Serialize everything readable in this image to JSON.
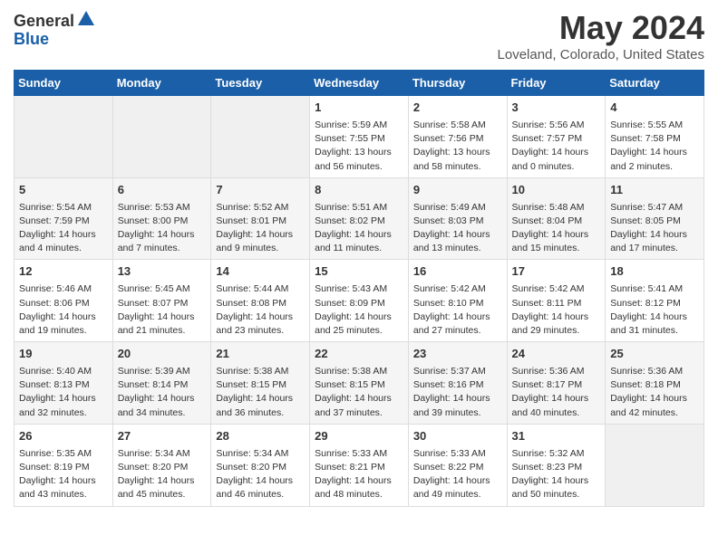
{
  "logo": {
    "general": "General",
    "blue": "Blue"
  },
  "title": "May 2024",
  "subtitle": "Loveland, Colorado, United States",
  "days": [
    "Sunday",
    "Monday",
    "Tuesday",
    "Wednesday",
    "Thursday",
    "Friday",
    "Saturday"
  ],
  "weeks": [
    [
      {
        "day": "",
        "sunrise": "",
        "sunset": "",
        "daylight": "",
        "empty": true
      },
      {
        "day": "",
        "sunrise": "",
        "sunset": "",
        "daylight": "",
        "empty": true
      },
      {
        "day": "",
        "sunrise": "",
        "sunset": "",
        "daylight": "",
        "empty": true
      },
      {
        "day": "1",
        "sunrise": "Sunrise: 5:59 AM",
        "sunset": "Sunset: 7:55 PM",
        "daylight": "Daylight: 13 hours and 56 minutes."
      },
      {
        "day": "2",
        "sunrise": "Sunrise: 5:58 AM",
        "sunset": "Sunset: 7:56 PM",
        "daylight": "Daylight: 13 hours and 58 minutes."
      },
      {
        "day": "3",
        "sunrise": "Sunrise: 5:56 AM",
        "sunset": "Sunset: 7:57 PM",
        "daylight": "Daylight: 14 hours and 0 minutes."
      },
      {
        "day": "4",
        "sunrise": "Sunrise: 5:55 AM",
        "sunset": "Sunset: 7:58 PM",
        "daylight": "Daylight: 14 hours and 2 minutes."
      }
    ],
    [
      {
        "day": "5",
        "sunrise": "Sunrise: 5:54 AM",
        "sunset": "Sunset: 7:59 PM",
        "daylight": "Daylight: 14 hours and 4 minutes."
      },
      {
        "day": "6",
        "sunrise": "Sunrise: 5:53 AM",
        "sunset": "Sunset: 8:00 PM",
        "daylight": "Daylight: 14 hours and 7 minutes."
      },
      {
        "day": "7",
        "sunrise": "Sunrise: 5:52 AM",
        "sunset": "Sunset: 8:01 PM",
        "daylight": "Daylight: 14 hours and 9 minutes."
      },
      {
        "day": "8",
        "sunrise": "Sunrise: 5:51 AM",
        "sunset": "Sunset: 8:02 PM",
        "daylight": "Daylight: 14 hours and 11 minutes."
      },
      {
        "day": "9",
        "sunrise": "Sunrise: 5:49 AM",
        "sunset": "Sunset: 8:03 PM",
        "daylight": "Daylight: 14 hours and 13 minutes."
      },
      {
        "day": "10",
        "sunrise": "Sunrise: 5:48 AM",
        "sunset": "Sunset: 8:04 PM",
        "daylight": "Daylight: 14 hours and 15 minutes."
      },
      {
        "day": "11",
        "sunrise": "Sunrise: 5:47 AM",
        "sunset": "Sunset: 8:05 PM",
        "daylight": "Daylight: 14 hours and 17 minutes."
      }
    ],
    [
      {
        "day": "12",
        "sunrise": "Sunrise: 5:46 AM",
        "sunset": "Sunset: 8:06 PM",
        "daylight": "Daylight: 14 hours and 19 minutes."
      },
      {
        "day": "13",
        "sunrise": "Sunrise: 5:45 AM",
        "sunset": "Sunset: 8:07 PM",
        "daylight": "Daylight: 14 hours and 21 minutes."
      },
      {
        "day": "14",
        "sunrise": "Sunrise: 5:44 AM",
        "sunset": "Sunset: 8:08 PM",
        "daylight": "Daylight: 14 hours and 23 minutes."
      },
      {
        "day": "15",
        "sunrise": "Sunrise: 5:43 AM",
        "sunset": "Sunset: 8:09 PM",
        "daylight": "Daylight: 14 hours and 25 minutes."
      },
      {
        "day": "16",
        "sunrise": "Sunrise: 5:42 AM",
        "sunset": "Sunset: 8:10 PM",
        "daylight": "Daylight: 14 hours and 27 minutes."
      },
      {
        "day": "17",
        "sunrise": "Sunrise: 5:42 AM",
        "sunset": "Sunset: 8:11 PM",
        "daylight": "Daylight: 14 hours and 29 minutes."
      },
      {
        "day": "18",
        "sunrise": "Sunrise: 5:41 AM",
        "sunset": "Sunset: 8:12 PM",
        "daylight": "Daylight: 14 hours and 31 minutes."
      }
    ],
    [
      {
        "day": "19",
        "sunrise": "Sunrise: 5:40 AM",
        "sunset": "Sunset: 8:13 PM",
        "daylight": "Daylight: 14 hours and 32 minutes."
      },
      {
        "day": "20",
        "sunrise": "Sunrise: 5:39 AM",
        "sunset": "Sunset: 8:14 PM",
        "daylight": "Daylight: 14 hours and 34 minutes."
      },
      {
        "day": "21",
        "sunrise": "Sunrise: 5:38 AM",
        "sunset": "Sunset: 8:15 PM",
        "daylight": "Daylight: 14 hours and 36 minutes."
      },
      {
        "day": "22",
        "sunrise": "Sunrise: 5:38 AM",
        "sunset": "Sunset: 8:15 PM",
        "daylight": "Daylight: 14 hours and 37 minutes."
      },
      {
        "day": "23",
        "sunrise": "Sunrise: 5:37 AM",
        "sunset": "Sunset: 8:16 PM",
        "daylight": "Daylight: 14 hours and 39 minutes."
      },
      {
        "day": "24",
        "sunrise": "Sunrise: 5:36 AM",
        "sunset": "Sunset: 8:17 PM",
        "daylight": "Daylight: 14 hours and 40 minutes."
      },
      {
        "day": "25",
        "sunrise": "Sunrise: 5:36 AM",
        "sunset": "Sunset: 8:18 PM",
        "daylight": "Daylight: 14 hours and 42 minutes."
      }
    ],
    [
      {
        "day": "26",
        "sunrise": "Sunrise: 5:35 AM",
        "sunset": "Sunset: 8:19 PM",
        "daylight": "Daylight: 14 hours and 43 minutes."
      },
      {
        "day": "27",
        "sunrise": "Sunrise: 5:34 AM",
        "sunset": "Sunset: 8:20 PM",
        "daylight": "Daylight: 14 hours and 45 minutes."
      },
      {
        "day": "28",
        "sunrise": "Sunrise: 5:34 AM",
        "sunset": "Sunset: 8:20 PM",
        "daylight": "Daylight: 14 hours and 46 minutes."
      },
      {
        "day": "29",
        "sunrise": "Sunrise: 5:33 AM",
        "sunset": "Sunset: 8:21 PM",
        "daylight": "Daylight: 14 hours and 48 minutes."
      },
      {
        "day": "30",
        "sunrise": "Sunrise: 5:33 AM",
        "sunset": "Sunset: 8:22 PM",
        "daylight": "Daylight: 14 hours and 49 minutes."
      },
      {
        "day": "31",
        "sunrise": "Sunrise: 5:32 AM",
        "sunset": "Sunset: 8:23 PM",
        "daylight": "Daylight: 14 hours and 50 minutes."
      },
      {
        "day": "",
        "sunrise": "",
        "sunset": "",
        "daylight": "",
        "empty": true
      }
    ]
  ]
}
